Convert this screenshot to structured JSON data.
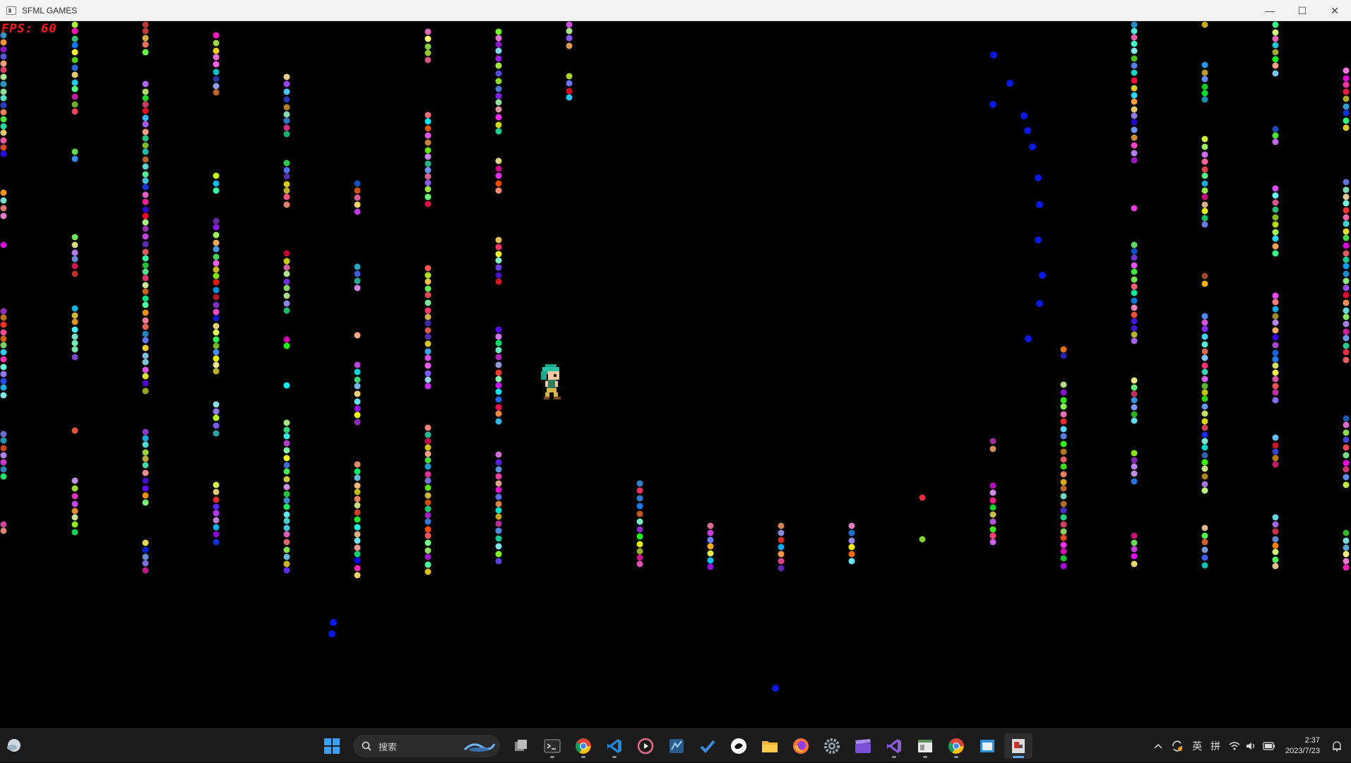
{
  "window": {
    "title": "SFML GAMES",
    "minimize_glyph": "—",
    "maximize_glyph": "☐",
    "close_glyph": "✕"
  },
  "hud": {
    "fps_text": "FPS: 60"
  },
  "taskbar": {
    "search_placeholder": "搜索",
    "apps": [
      {
        "name": "start-button",
        "icon": "windows-logo"
      },
      {
        "name": "task-view-button",
        "icon": "task-view"
      },
      {
        "name": "terminal-app",
        "icon": "terminal"
      },
      {
        "name": "chrome-app",
        "icon": "chrome"
      },
      {
        "name": "vscode-app",
        "icon": "vscode"
      },
      {
        "name": "media-player-app",
        "icon": "play"
      },
      {
        "name": "ssms-app",
        "icon": "database-tool"
      },
      {
        "name": "todo-app",
        "icon": "checkmark"
      },
      {
        "name": "chatgpt-app",
        "icon": "chat"
      },
      {
        "name": "file-explorer-app",
        "icon": "folder"
      },
      {
        "name": "firefox-app",
        "icon": "firefox"
      },
      {
        "name": "settings-app",
        "icon": "gear"
      },
      {
        "name": "clipchamp-app",
        "icon": "clapper"
      },
      {
        "name": "visual-studio-app",
        "icon": "visual-studio"
      },
      {
        "name": "window-app",
        "icon": "window"
      },
      {
        "name": "chrome-app-2",
        "icon": "chrome"
      },
      {
        "name": "remote-app",
        "icon": "window-blue"
      },
      {
        "name": "sfml-game-app",
        "icon": "game",
        "active": true
      }
    ],
    "tray": {
      "ime_lang": "英",
      "ime_mode": "拼",
      "time": "2:37",
      "date": "2023/7/23"
    }
  },
  "colors": {
    "titlebar_bg": "#f3f3f3",
    "game_bg": "#000000",
    "fps_color": "#ff1a1a",
    "taskbar_bg": "#1c1c1c",
    "accent": "#5ca8ff"
  }
}
